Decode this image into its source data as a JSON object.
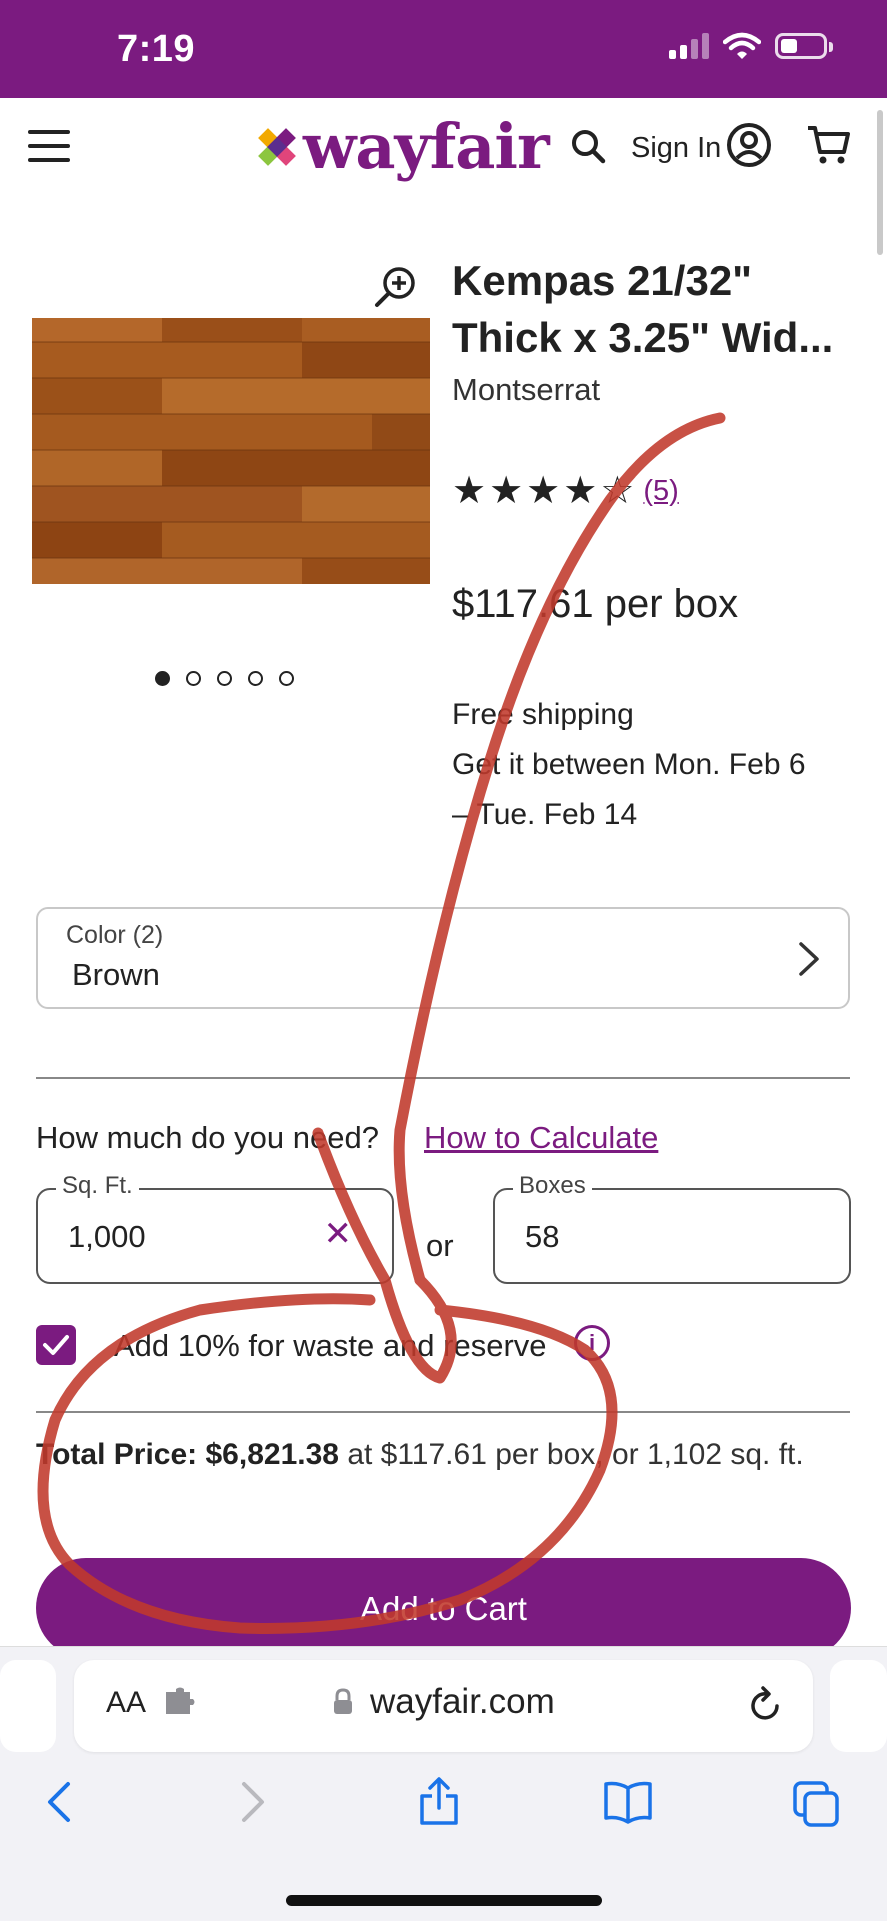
{
  "status_bar": {
    "time": "7:19"
  },
  "header": {
    "logo_text": "wayfair",
    "sign_in": "Sign In"
  },
  "product": {
    "title": "Kempas 21/32\" Thick x 3.25\" Wid...",
    "brand": "Montserrat",
    "rating": 4.5,
    "review_count": "(5)",
    "price": "$117.61 per box",
    "shipping_line1": "Free shipping",
    "shipping_line2": "Get it between Mon. Feb 6",
    "shipping_line3": "– Tue. Feb 14",
    "image_count": 5,
    "active_image": 1
  },
  "color_select": {
    "label": "Color (2)",
    "value": "Brown"
  },
  "quantity": {
    "question": "How much do you need?",
    "calc_link": "How to Calculate",
    "sqft_label": "Sq. Ft.",
    "sqft_value": "1,000",
    "or": "or",
    "boxes_label": "Boxes",
    "boxes_value": "58",
    "waste_label": "Add 10% for waste and reserve",
    "waste_checked": true,
    "info_icon": "i"
  },
  "total": {
    "label": "Total Price:",
    "amount": "$6,821.38",
    "detail": "at $117.61 per box, or 1,102 sq. ft."
  },
  "add_to_cart": "Add to Cart",
  "browser": {
    "text_size": "AA",
    "url": "wayfair.com"
  },
  "colors": {
    "brand": "#7b1b80",
    "annotation": "#c0392b"
  }
}
